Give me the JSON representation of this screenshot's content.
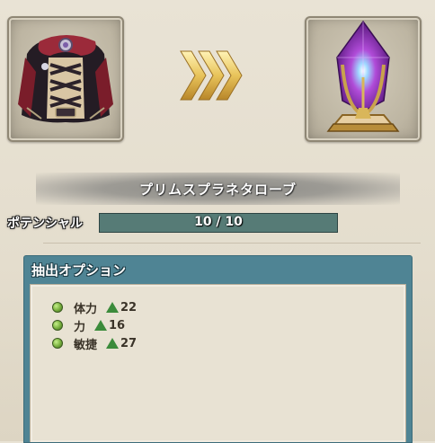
{
  "item_before": {
    "icon": "robe-icon"
  },
  "transfer_arrows": {
    "icon": "chevron-right-icon"
  },
  "item_after": {
    "icon": "crystal-icon"
  },
  "item_name": "プリムスプラネタローブ",
  "potential": {
    "label": "ポテンシャル",
    "current": 10,
    "max": 10,
    "text": "10 / 10"
  },
  "options_panel": {
    "title": "抽出オプション",
    "items": [
      {
        "stat": "体力",
        "value": "22"
      },
      {
        "stat": "力",
        "value": "16"
      },
      {
        "stat": "敏捷",
        "value": "27"
      }
    ]
  },
  "colors": {
    "panel_header": "#4f8494",
    "potential_bar": "#4c6e6a",
    "stat_up": "#3b8b3b"
  }
}
